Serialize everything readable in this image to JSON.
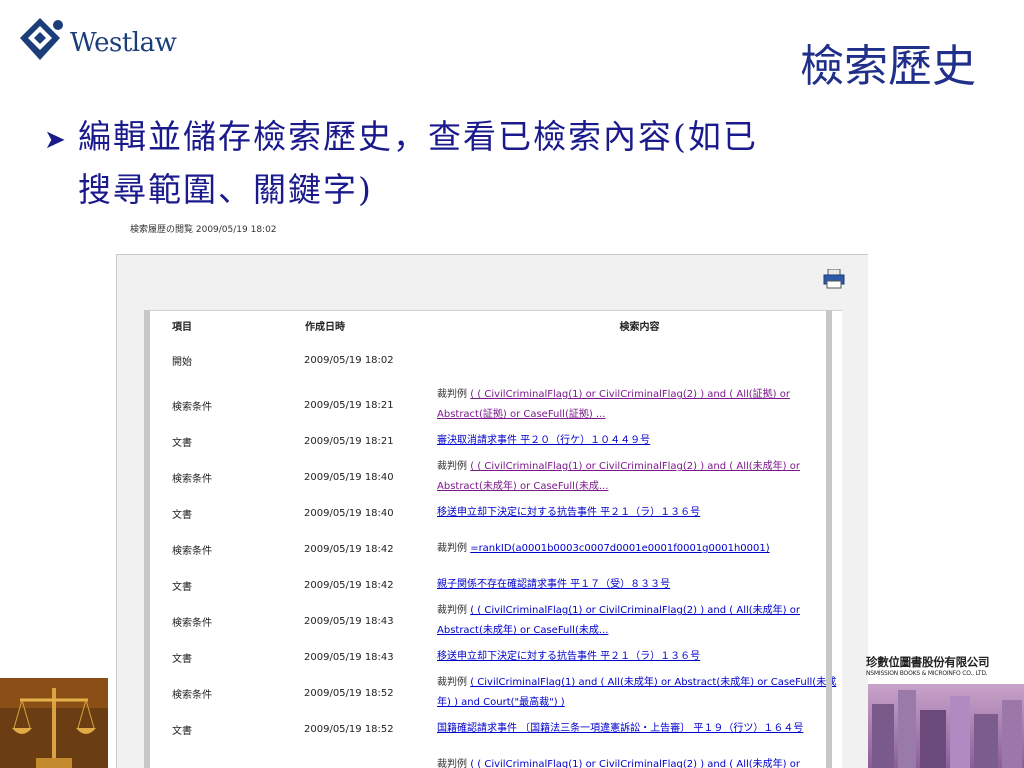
{
  "logo": {
    "brand": "Westlaw"
  },
  "slide": {
    "title": "檢索歷史",
    "bullet_line1": "編輯並儲存檢索歷史，查看已檢索內容(如已",
    "bullet_line2": "搜尋範圍、關鍵字)"
  },
  "screenshot": {
    "window_title": "検索履歴の閲覧  2009/05/19 18:02",
    "printer_icon": "printer-icon",
    "headers": {
      "item": "項目",
      "date": "作成日時",
      "content": "検索内容"
    },
    "rows": [
      {
        "item": "開始",
        "date": "2009/05/19 18:02",
        "prefix": "",
        "content": "",
        "style": "none"
      },
      {
        "item": "検索条件",
        "date": "2009/05/19 18:21",
        "prefix": "裁判例",
        "content": "( ( CivilCriminalFlag(1) or CivilCriminalFlag(2) ) and ( All(証拠) or Abstract(証拠) or CaseFull(証拠) ...",
        "style": "vis"
      },
      {
        "item": "文書",
        "date": "2009/05/19 18:21",
        "prefix": "",
        "content": "審決取消請求事件 平２０（行ケ）１０４４９号",
        "style": "lnk"
      },
      {
        "item": "検索条件",
        "date": "2009/05/19 18:40",
        "prefix": "裁判例",
        "content": "( ( CivilCriminalFlag(1) or CivilCriminalFlag(2) ) and ( All(未成年) or Abstract(未成年) or CaseFull(未成...",
        "style": "vis"
      },
      {
        "item": "文書",
        "date": "2009/05/19 18:40",
        "prefix": "",
        "content": "移送申立却下決定に対する抗告事件 平２１（ラ）１３６号",
        "style": "lnk"
      },
      {
        "item": "検索条件",
        "date": "2009/05/19 18:42",
        "prefix": "裁判例",
        "content": "=rankID(a0001b0003c0007d0001e0001f0001g0001h0001)",
        "style": "lnk"
      },
      {
        "item": "文書",
        "date": "2009/05/19 18:42",
        "prefix": "",
        "content": "親子関係不存在確認請求事件 平１７（受）８３３号",
        "style": "lnk"
      },
      {
        "item": "検索条件",
        "date": "2009/05/19 18:43",
        "prefix": "裁判例",
        "content": "( ( CivilCriminalFlag(1) or CivilCriminalFlag(2) ) and ( All(未成年) or Abstract(未成年) or CaseFull(未成...",
        "style": "lnk"
      },
      {
        "item": "文書",
        "date": "2009/05/19 18:43",
        "prefix": "",
        "content": "移送申立却下決定に対する抗告事件 平２１（ラ）１３６号",
        "style": "lnk"
      },
      {
        "item": "検索条件",
        "date": "2009/05/19 18:52",
        "prefix": "裁判例",
        "content": "( CivilCriminalFlag(1) and ( All(未成年) or Abstract(未成年) or CaseFull(未成年) ) and Court(\"最高裁\") )",
        "style": "lnk"
      },
      {
        "item": "文書",
        "date": "2009/05/19 18:52",
        "prefix": "",
        "content": "国籍確認請求事件 〔国籍法三条一項違憲訴訟・上告審〕 平１９（行ツ）１６４号",
        "style": "lnk"
      },
      {
        "item": "",
        "date": "",
        "prefix": "裁判例",
        "content": "( ( CivilCriminalFlag(1) or CivilCriminalFlag(2) ) and ( All(未成年) or",
        "style": "lnk"
      }
    ]
  },
  "company": {
    "name_cn": "珍數位圖書股份有限公司",
    "name_en": "NSMISSION BOOKS & MICROINFO CO., LTD."
  },
  "colors": {
    "title_blue": "#1f2f8a",
    "bullet_blue": "#1a1a8c",
    "link_blue": "#0000cc",
    "visited": "#7a1a8a"
  }
}
